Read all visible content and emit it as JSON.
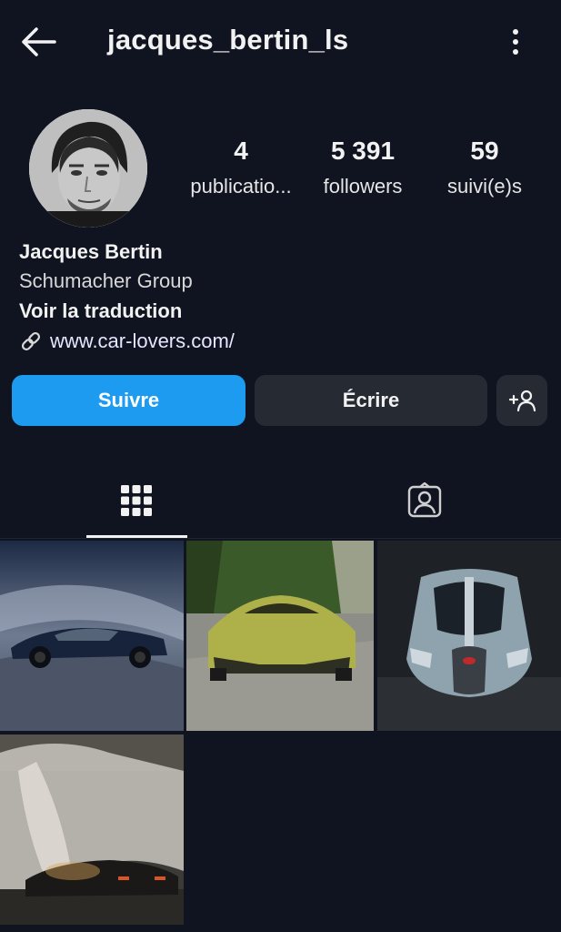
{
  "header": {
    "username": "jacques_bertin_ls",
    "back_icon": "arrow-left-icon",
    "more_icon": "vertical-dots-icon"
  },
  "stats": {
    "posts_count": "4",
    "posts_label": "publicatio...",
    "followers_count": "5 391",
    "followers_label": "followers",
    "following_count": "59",
    "following_label": "suivi(e)s"
  },
  "bio": {
    "name": "Jacques Bertin",
    "category": "Schumacher Group",
    "translate": "Voir la traduction",
    "link": "www.car-lovers.com/"
  },
  "actions": {
    "follow_label": "Suivre",
    "message_label": "Écrire",
    "follow_color": "#1d9bf0"
  },
  "tabs": [
    {
      "icon": "grid-icon",
      "active": true
    },
    {
      "icon": "tagged-person-icon",
      "active": false
    }
  ],
  "posts": [
    {
      "subject": "dark blue hypercar on grey backdrop"
    },
    {
      "subject": "yellow-green supercar on forest road"
    },
    {
      "subject": "silver hypercar front view"
    },
    {
      "subject": "covered car reveal in studio"
    }
  ]
}
